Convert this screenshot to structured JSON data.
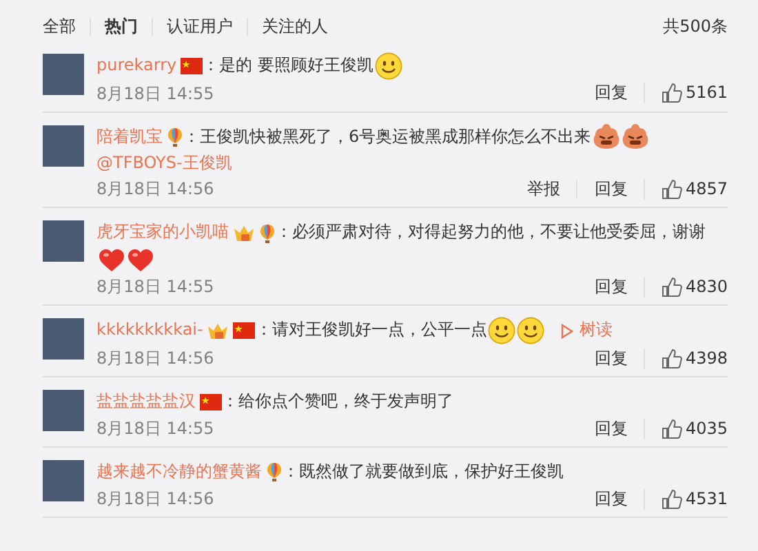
{
  "tabs": [
    {
      "label": "全部",
      "selected": false
    },
    {
      "label": "热门",
      "selected": true
    },
    {
      "label": "认证用户",
      "selected": false
    },
    {
      "label": "关注的人",
      "selected": false
    }
  ],
  "total": "共500条",
  "comments": [
    {
      "user": "purekarry",
      "badges": [
        {
          "kind": "flag"
        }
      ],
      "text": "：是的 要照顾好王俊凯",
      "emoticons": [
        {
          "kind": "smile"
        }
      ],
      "date": "8月18日 14:55",
      "actions": [
        "回复"
      ],
      "likes": "5161"
    },
    {
      "user": "陪着凯宝",
      "badges": [
        {
          "kind": "balloon"
        }
      ],
      "text": "：王俊凯快被黑死了，6号奥运被黑成那样你怎么不出来",
      "emoticons": [
        {
          "kind": "angry"
        },
        {
          "kind": "angry"
        }
      ],
      "mention": "@TFBOYS-王俊凯",
      "date": "8月18日 14:56",
      "actions": [
        "举报",
        "回复"
      ],
      "likes": "4857"
    },
    {
      "user": "虎牙宝家的小凯喵",
      "badges": [
        {
          "kind": "crown"
        },
        {
          "kind": "balloon"
        }
      ],
      "text": "：必须严肃对待，对得起努力的他，不要让他受委屈，谢谢",
      "emoticons": [
        {
          "kind": "heart"
        },
        {
          "kind": "heart"
        }
      ],
      "date": "8月18日 14:55",
      "actions": [
        "回复"
      ],
      "likes": "4830"
    },
    {
      "user": "kkkkkkkkkai-",
      "badges": [
        {
          "kind": "crown"
        },
        {
          "kind": "flag"
        }
      ],
      "text": "：请对王俊凯好一点，公平一点",
      "emoticons": [
        {
          "kind": "smile"
        },
        {
          "kind": "smile"
        }
      ],
      "link": "树读",
      "date": "8月18日 14:56",
      "actions": [
        "回复"
      ],
      "likes": "4398"
    },
    {
      "user": "盐盐盐盐盐汉",
      "badges": [
        {
          "kind": "flag"
        }
      ],
      "text": "：给你点个赞吧，终于发声明了",
      "date": "8月18日 14:55",
      "actions": [
        "回复"
      ],
      "likes": "4035"
    },
    {
      "user": "越来越不冷静的蟹黄酱",
      "badges": [
        {
          "kind": "balloon"
        }
      ],
      "text": "：既然做了就要做到底，保护好王俊凯",
      "date": "8月18日 14:56",
      "actions": [
        "回复"
      ],
      "likes": "4531"
    }
  ]
}
